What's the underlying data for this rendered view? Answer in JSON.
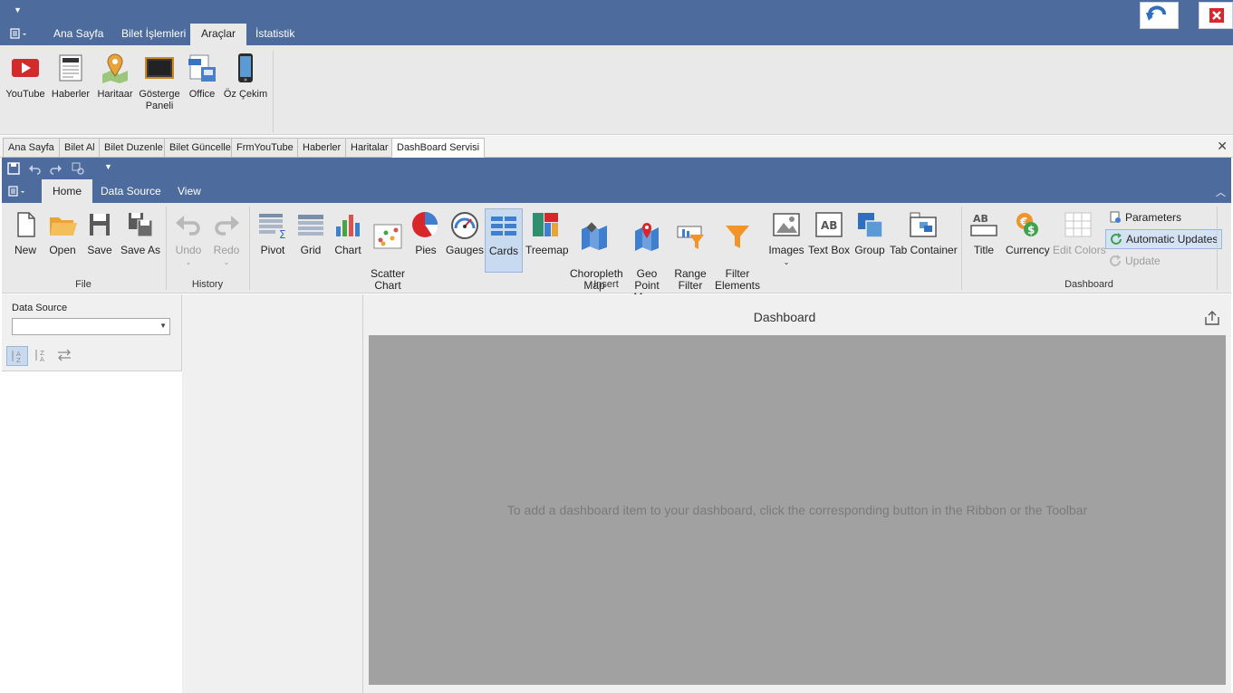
{
  "outer": {
    "tabs": [
      "Ana Sayfa",
      "Bilet İşlemleri",
      "Araçlar",
      "İstatistik"
    ],
    "active_tab": "Araçlar",
    "ribbon_buttons": [
      {
        "label": "YouTube",
        "icon": "youtube-icon"
      },
      {
        "label": "Haberler",
        "icon": "news-icon"
      },
      {
        "label": "Haritaar",
        "icon": "map-pin-icon"
      },
      {
        "label": "Gösterge Paneli",
        "icon": "dashboard-screen-icon"
      },
      {
        "label": "Office",
        "icon": "office-doc-icon"
      },
      {
        "label": "Öz Çekim",
        "icon": "phone-icon"
      }
    ]
  },
  "doc_tabs": [
    "Ana Sayfa",
    "Bilet Al",
    "Bilet Duzenle",
    "Bilet Güncelle",
    "FrmYouTube",
    "Haberler",
    "Haritalar",
    "DashBoard Servisi"
  ],
  "designer": {
    "tabs": [
      "Home",
      "Data Source",
      "View"
    ],
    "active_tab": "Home",
    "file_group": {
      "label": "File",
      "buttons": [
        "New",
        "Open",
        "Save",
        "Save As"
      ]
    },
    "history_group": {
      "label": "History",
      "buttons": [
        "Undo",
        "Redo"
      ]
    },
    "insert_group": {
      "label": "Insert",
      "buttons": [
        "Pivot",
        "Grid",
        "Chart",
        "Scatter\nChart",
        "Pies",
        "Gauges",
        "Cards",
        "Treemap",
        "Choropleth\nMap",
        "Geo Point\nMaps",
        "Range\nFilter",
        "Filter\nElements",
        "Images",
        "Text Box",
        "Group",
        "Tab Container"
      ],
      "selected": "Cards"
    },
    "dashboard_group": {
      "label": "Dashboard",
      "buttons": [
        "Title",
        "Currency",
        "Edit Colors"
      ],
      "small_buttons": [
        "Parameters",
        "Automatic Updates",
        "Update"
      ]
    }
  },
  "left_pane": {
    "data_source_label": "Data Source",
    "data_source_value": ""
  },
  "dashboard": {
    "title": "Dashboard",
    "hint": "To add a dashboard item to your dashboard, click the corresponding button in the Ribbon or the Toolbar"
  },
  "colors": {
    "title_bar": "#4d6b9c",
    "ribbon": "#e9e9e9",
    "canvas": "#a1a1a1",
    "accent": "#2f6fc0"
  }
}
